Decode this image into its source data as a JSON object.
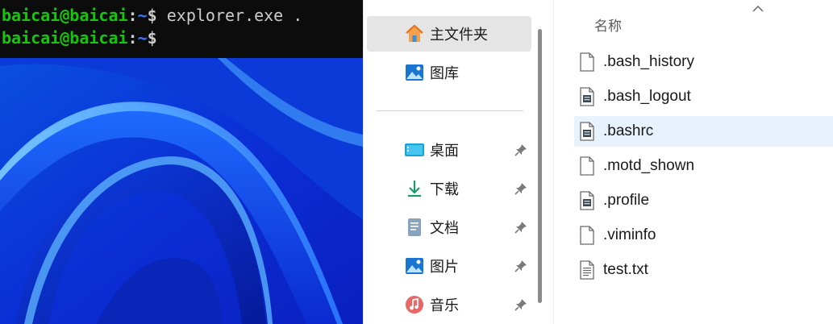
{
  "terminal": {
    "line1": {
      "user": "baicai@baicai",
      "sep": ":",
      "path": "~",
      "prompt": "$ ",
      "command": "explorer.exe ."
    },
    "line2": {
      "user": "baicai@baicai",
      "sep": ":",
      "path": "~",
      "prompt": "$"
    },
    "partial_top": "                 ¯      ¯"
  },
  "nav": {
    "items": [
      {
        "label": "主文件夹",
        "icon": "home-icon"
      },
      {
        "label": "图库",
        "icon": "gallery-icon"
      },
      {
        "label": "桌面",
        "icon": "desktop-icon",
        "pinned": true
      },
      {
        "label": "下载",
        "icon": "download-icon",
        "pinned": true
      },
      {
        "label": "文档",
        "icon": "documents-icon",
        "pinned": true
      },
      {
        "label": "图片",
        "icon": "pictures-icon",
        "pinned": true
      },
      {
        "label": "音乐",
        "icon": "music-icon",
        "pinned": true
      }
    ]
  },
  "content": {
    "column_name": "名称",
    "files": [
      {
        "name": ".bash_history",
        "icon": "blank-file-icon"
      },
      {
        "name": ".bash_logout",
        "icon": "config-file-icon"
      },
      {
        "name": ".bashrc",
        "icon": "config-file-icon",
        "selected": true
      },
      {
        "name": ".motd_shown",
        "icon": "blank-file-icon"
      },
      {
        "name": ".profile",
        "icon": "config-file-icon"
      },
      {
        "name": ".viminfo",
        "icon": "blank-file-icon"
      },
      {
        "name": "test.txt",
        "icon": "text-file-icon"
      }
    ]
  },
  "colors": {
    "terminal_bg": "#0c0c0c",
    "prompt_user": "#16c60c",
    "prompt_path": "#3b78ff",
    "nav_selected": "#e5e5e5",
    "row_selected": "#e8f2fc"
  }
}
